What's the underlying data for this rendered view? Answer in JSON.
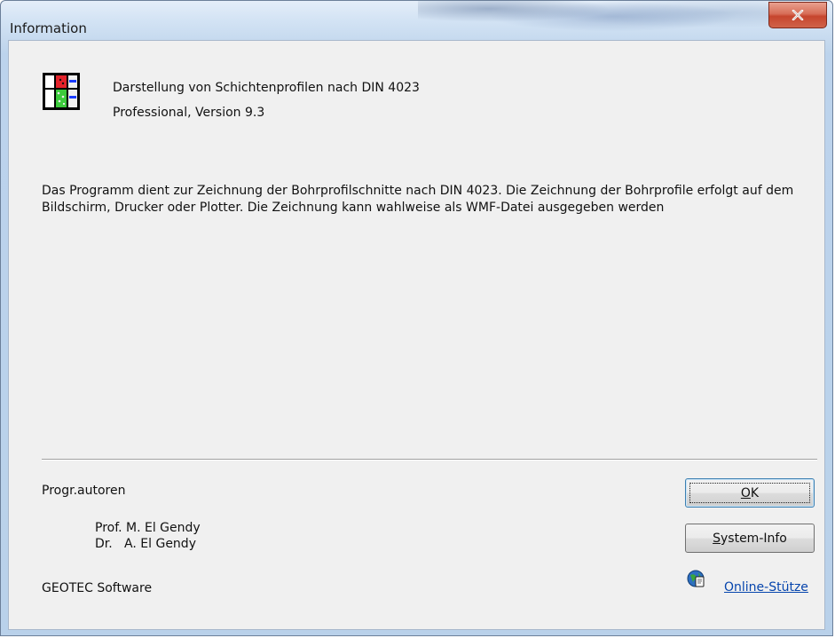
{
  "window": {
    "title": "Information"
  },
  "product": {
    "line1": "Darstellung von Schichtenprofilen nach DIN 4023",
    "line2": "Professional, Version 9.3"
  },
  "description": "Das Programm dient zur Zeichnung der Bohrprofilschnitte nach DIN 4023. Die Zeichnung der Bohrprofile erfolgt auf dem Bildschirm, Drucker oder Plotter. Die Zeichnung kann wahlweise als WMF-Datei ausgegeben werden",
  "authors": {
    "label": "Progr.autoren",
    "names": [
      "Prof. M. El Gendy",
      "Dr.   A. El Gendy"
    ]
  },
  "company": "GEOTEC Software",
  "buttons": {
    "ok": {
      "mnemonic": "O",
      "rest": "K"
    },
    "system_info": {
      "mnemonic": "S",
      "rest": "ystem-Info"
    }
  },
  "online_help": {
    "label": "Online-Stütze",
    "icon": "globe-help-icon"
  },
  "icons": {
    "app": "soil-profile-app-icon",
    "close": "close-icon"
  },
  "colors": {
    "close_button": "#c6452d",
    "link": "#0645ad",
    "dialog_bg": "#f0f0f0"
  }
}
